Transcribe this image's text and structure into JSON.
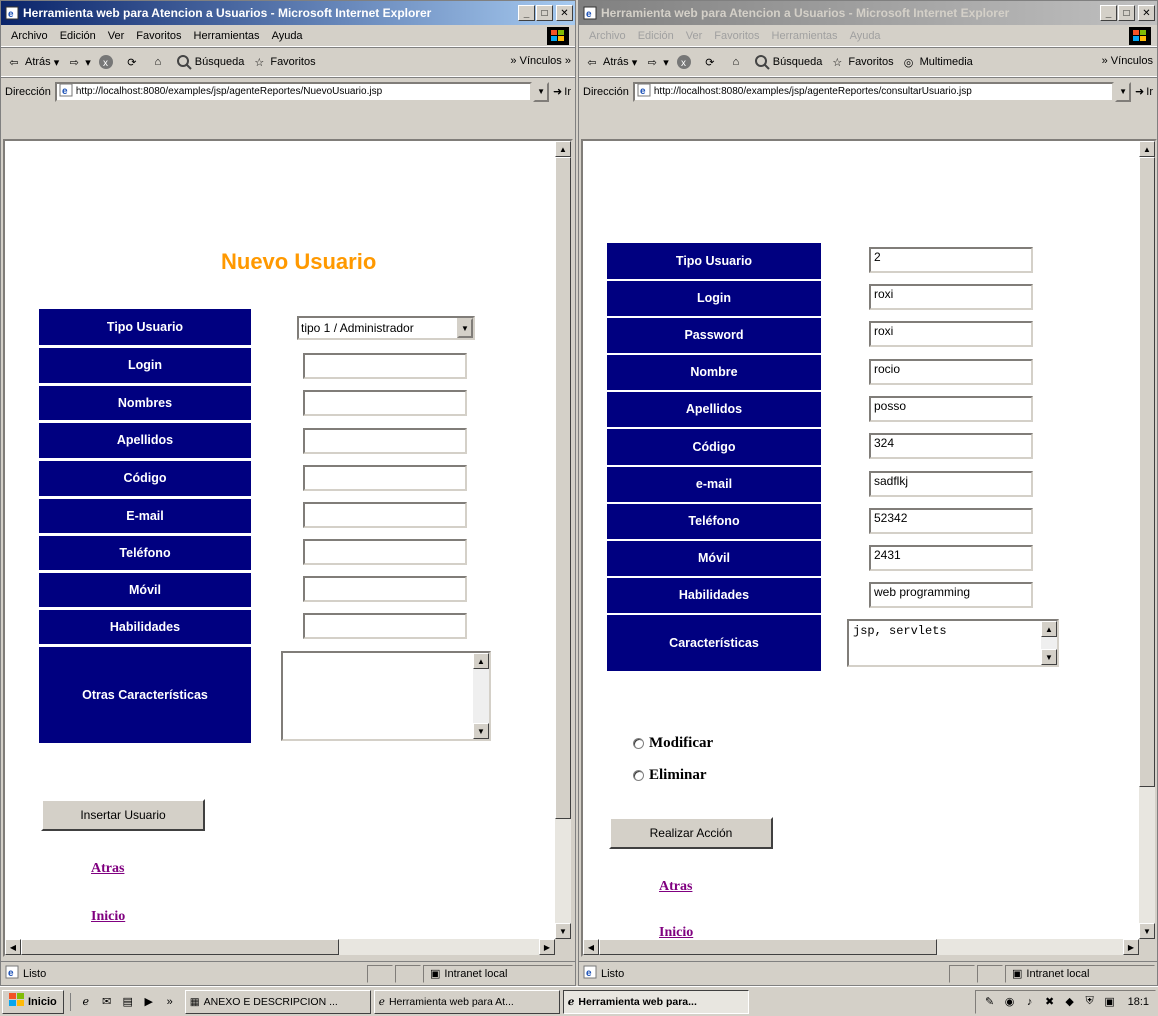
{
  "windows": {
    "left": {
      "title": "Herramienta web para Atencion a Usuarios - Microsoft Internet Explorer",
      "menu": [
        "Archivo",
        "Edición",
        "Ver",
        "Favoritos",
        "Herramientas",
        "Ayuda"
      ],
      "toolbar": {
        "back": "Atrás",
        "search": "Búsqueda",
        "favorites": "Favoritos",
        "links": "Vínculos"
      },
      "address_label": "Dirección",
      "address": "http://localhost:8080/examples/jsp/agenteReportes/NuevoUsuario.jsp",
      "go_label": "Ir",
      "status": "Listo",
      "zone": "Intranet local",
      "page": {
        "heading": "Nuevo Usuario",
        "labels": {
          "tipo": "Tipo Usuario",
          "login": "Login",
          "nombres": "Nombres",
          "apellidos": "Apellidos",
          "codigo": "Código",
          "email": "E-mail",
          "telefono": "Teléfono",
          "movil": "Móvil",
          "habilidades": "Habilidades",
          "otras": "Otras Características"
        },
        "tipo_value": "tipo 1 / Administrador",
        "insert_button": "Insertar Usuario",
        "link_back": "Atras",
        "link_home": "Inicio"
      }
    },
    "right": {
      "title": "Herramienta web para Atencion a Usuarios - Microsoft Internet Explorer",
      "menu": [
        "Archivo",
        "Edición",
        "Ver",
        "Favoritos",
        "Herramientas",
        "Ayuda"
      ],
      "toolbar": {
        "back": "Atrás",
        "search": "Búsqueda",
        "favorites": "Favoritos",
        "multimedia": "Multimedia",
        "links": "Vínculos"
      },
      "address_label": "Dirección",
      "address": "http://localhost:8080/examples/jsp/agenteReportes/consultarUsuario.jsp",
      "go_label": "Ir",
      "status": "Listo",
      "zone": "Intranet local",
      "page": {
        "labels": {
          "tipo": "Tipo Usuario",
          "login": "Login",
          "password": "Password",
          "nombre": "Nombre",
          "apellidos": "Apellidos",
          "codigo": "Código",
          "email": "e-mail",
          "telefono": "Teléfono",
          "movil": "Móvil",
          "habilidades": "Habilidades",
          "caracteristicas": "Características"
        },
        "values": {
          "tipo": "2",
          "login": "roxi",
          "password": "roxi",
          "nombre": "rocio",
          "apellidos": "posso",
          "codigo": "324",
          "email": "sadflkj",
          "telefono": "52342",
          "movil": "2431",
          "habilidades": "web programming",
          "caracteristicas": "jsp, servlets"
        },
        "radio_modify": "Modificar",
        "radio_delete": "Eliminar",
        "action_button": "Realizar Acción",
        "link_back": "Atras",
        "link_home_partial": "Inicio"
      }
    }
  },
  "taskbar": {
    "start": "Inicio",
    "tasks": [
      "ANEXO E DESCRIPCION ...",
      "Herramienta web para At...",
      "Herramienta web para..."
    ],
    "clock": "18:1"
  },
  "colors": {
    "label_bg": "#000080",
    "heading": "#ff9900",
    "link": "#800080"
  }
}
